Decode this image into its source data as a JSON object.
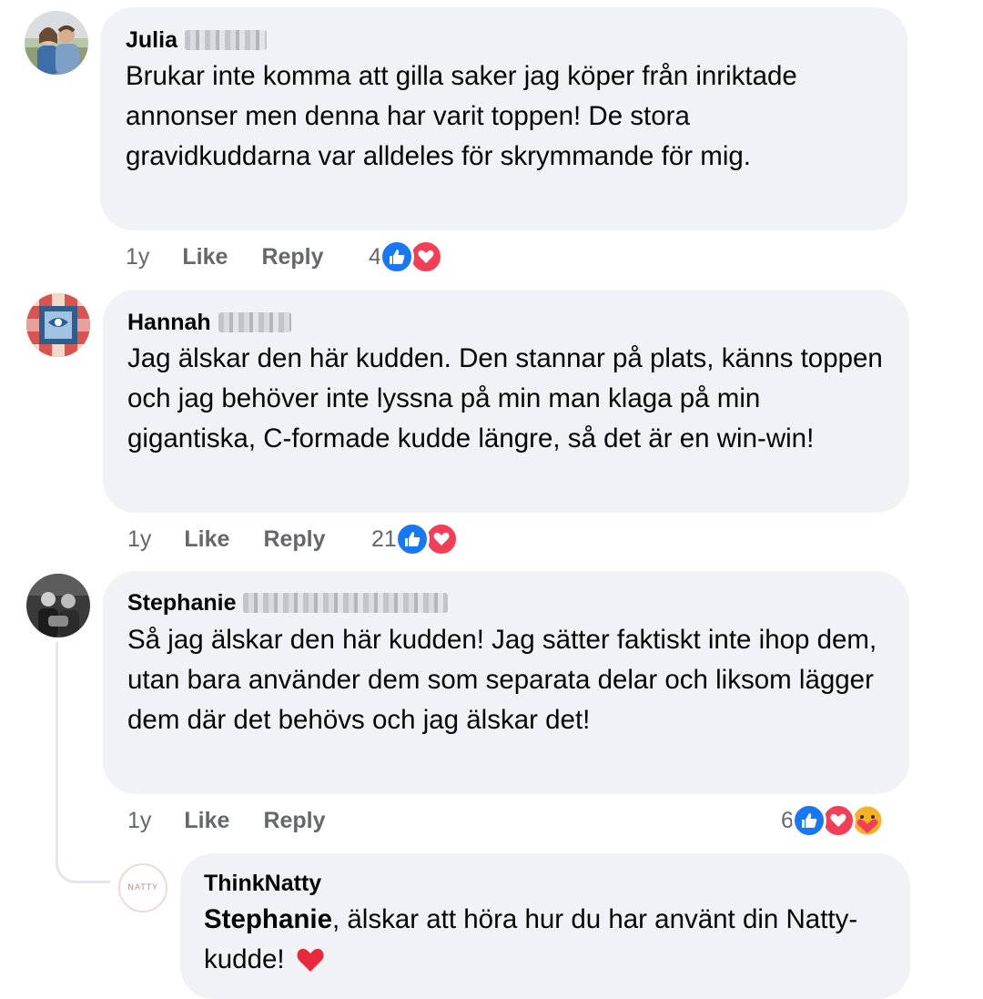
{
  "comments": [
    {
      "name": "Julia",
      "text": "Brukar inte komma att gilla saker jag köper från inriktade annonser men denna har varit toppen! De stora gravidkuddarna var alldeles för skrymmande för mig.",
      "time": "1y",
      "like_label": "Like",
      "reply_label": "Reply",
      "reaction_count": "4",
      "reactions": [
        "like-icon",
        "love-icon"
      ]
    },
    {
      "name": "Hannah",
      "text": "Jag älskar den här kudden. Den stannar på plats, känns toppen och jag behöver inte lyssna på min man klaga på min gigantiska, C-formade kudde längre, så det är en win-win!",
      "time": "1y",
      "like_label": "Like",
      "reply_label": "Reply",
      "reaction_count": "21",
      "reactions": [
        "like-icon",
        "love-icon"
      ]
    },
    {
      "name": "Stephanie",
      "text": "Så jag älskar den här kudden! Jag sätter faktiskt inte ihop dem, utan bara använder dem som separata delar och liksom lägger dem där det behövs och jag älskar det!",
      "time": "1y",
      "like_label": "Like",
      "reply_label": "Reply",
      "reaction_count": "6",
      "reactions": [
        "like-icon",
        "love-icon",
        "care-icon"
      ]
    }
  ],
  "reply": {
    "name": "ThinkNatty",
    "avatar_text": "NATTY",
    "mention": "Stephanie",
    "text": ", älskar att höra hur du har använt din Natty-kudde!",
    "emoji": "❤️"
  },
  "colors": {
    "bubble": "#f0f2f5",
    "like_blue": "#1877f2",
    "love_red": "#f33e58",
    "meta_gray": "#65676b"
  }
}
